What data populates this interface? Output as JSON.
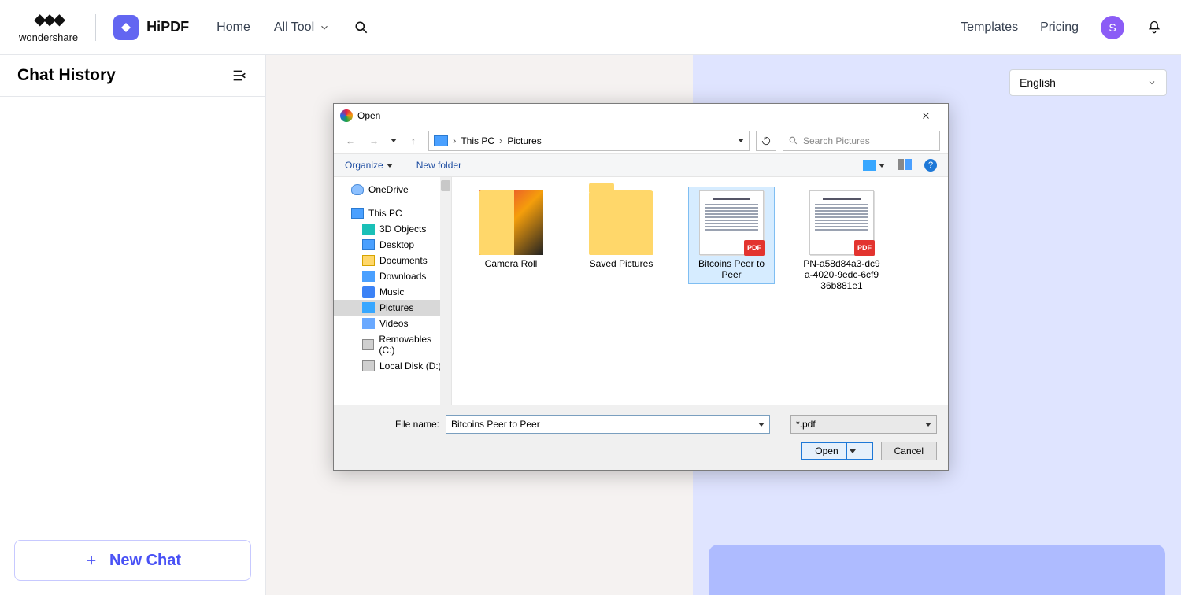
{
  "topnav": {
    "brand": "wondershare",
    "hipdf": "HiPDF",
    "links": {
      "home": "Home",
      "all_tool": "All Tool"
    },
    "right": {
      "templates": "Templates",
      "pricing": "Pricing",
      "avatar_initial": "S"
    }
  },
  "sidebar": {
    "title": "Chat History",
    "new_chat": "New Chat"
  },
  "content": {
    "language": "English"
  },
  "dialog": {
    "title": "Open",
    "breadcrumb": {
      "root": "This PC",
      "folder": "Pictures"
    },
    "search_placeholder": "Search Pictures",
    "toolbar": {
      "organize": "Organize",
      "new_folder": "New folder"
    },
    "tree": {
      "onedrive": "OneDrive",
      "this_pc": "This PC",
      "objects3d": "3D Objects",
      "desktop": "Desktop",
      "documents": "Documents",
      "downloads": "Downloads",
      "music": "Music",
      "pictures": "Pictures",
      "videos": "Videos",
      "removables": "Removables (C:)",
      "local_disk": "Local Disk (D:)"
    },
    "files": {
      "camera_roll": "Camera Roll",
      "saved_pictures": "Saved Pictures",
      "bitcoin": "Bitcoins Peer to Peer",
      "pn": "PN-a58d84a3-dc9a-4020-9edc-6cf936b881e1",
      "pdf_badge": "PDF"
    },
    "footer": {
      "file_name_label": "File name:",
      "file_name_value": "Bitcoins Peer to Peer",
      "file_type": "*.pdf",
      "open": "Open",
      "cancel": "Cancel"
    }
  }
}
